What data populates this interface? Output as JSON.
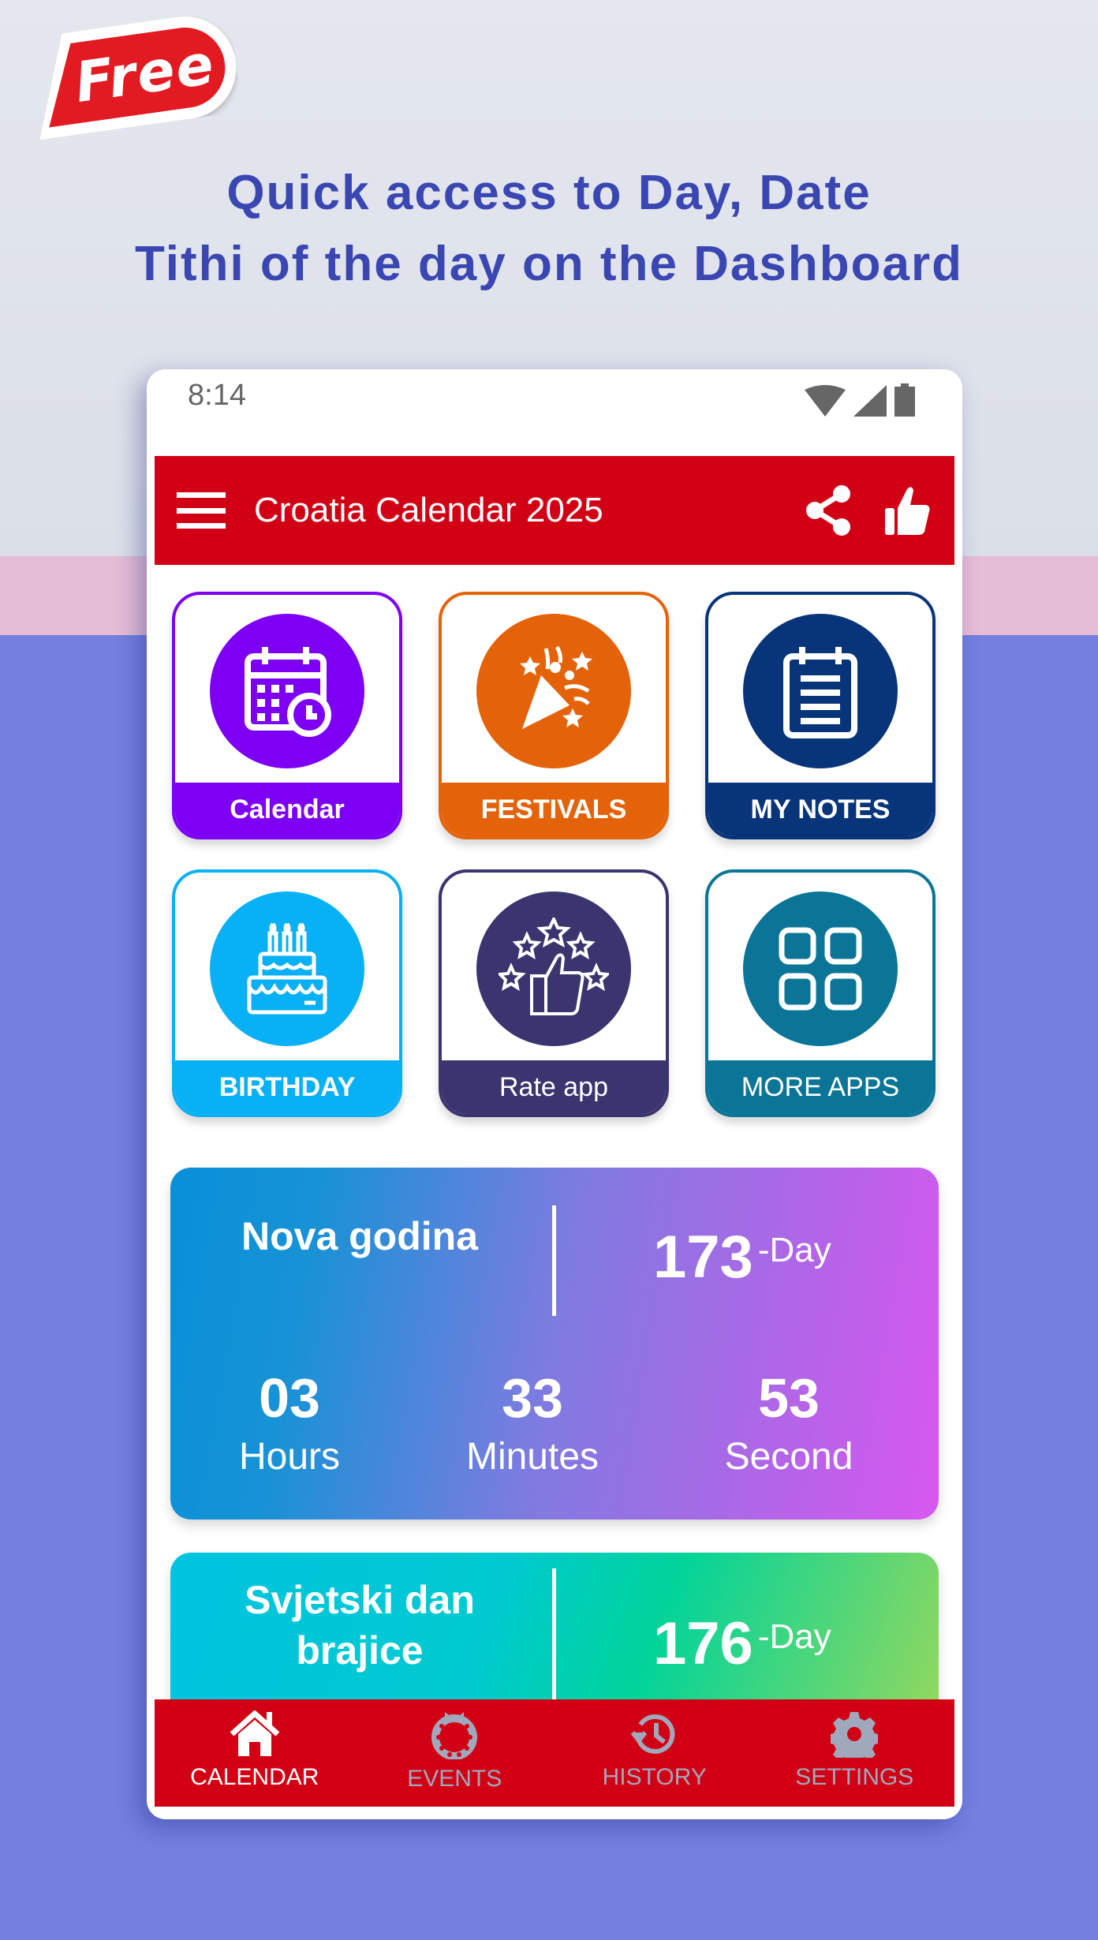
{
  "promo": {
    "badge": "Free",
    "headline_line1": "Quick access to Day, Date",
    "headline_line2": "Tithi of the day on the Dashboard"
  },
  "status_bar": {
    "time": "8:14",
    "icons": [
      "wifi-icon",
      "signal-icon",
      "battery-icon"
    ]
  },
  "app_bar": {
    "title": "Croatia Calendar 2025",
    "actions": [
      "share-icon",
      "thumbs-up-icon"
    ],
    "color": "#d20014"
  },
  "tiles": [
    {
      "label": "Calendar",
      "icon": "calendar-clock-icon",
      "color": "#7d00f5"
    },
    {
      "label": "FESTIVALS",
      "icon": "party-popper-icon",
      "color": "#e4630a"
    },
    {
      "label": "MY NOTES",
      "icon": "notepad-icon",
      "color": "#08347a"
    },
    {
      "label": "BIRTHDAY",
      "icon": "birthday-cake-icon",
      "color": "#08b0f5"
    },
    {
      "label": "Rate app",
      "icon": "rate-thumbs-stars-icon",
      "color": "#3a356e"
    },
    {
      "label": "MORE APPS",
      "icon": "grid-apps-icon",
      "color": "#0a7596"
    }
  ],
  "countdowns": [
    {
      "name": "Nova godina",
      "days": "173",
      "days_unit": "-Day",
      "hours": "03",
      "hours_label": "Hours",
      "minutes": "33",
      "minutes_label": "Minutes",
      "seconds": "53",
      "seconds_label": "Second"
    },
    {
      "name_line1": "Svjetski dan",
      "name_line2": "brajice",
      "days": "176",
      "days_unit": "-Day"
    }
  ],
  "bottom_nav": [
    {
      "label": "CALENDAR",
      "icon": "home-icon",
      "active": true
    },
    {
      "label": "EVENTS",
      "icon": "wreath-icon",
      "active": false
    },
    {
      "label": "HISTORY",
      "icon": "history-icon",
      "active": false
    },
    {
      "label": "SETTINGS",
      "icon": "gear-icon",
      "active": false
    }
  ]
}
